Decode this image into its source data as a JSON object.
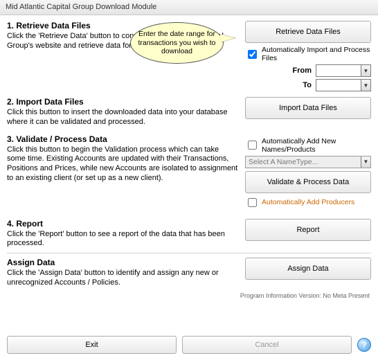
{
  "window": {
    "title": "Mid Atlantic Capital Group Download Module"
  },
  "sections": {
    "retrieve": {
      "heading": "1. Retrieve Data Files",
      "desc": "Click the 'Retrieve Data' button to connect to Mid Atlantic Capital Group's website and retrieve data for the specified date range.",
      "button": "Retrieve Data Files",
      "auto_import_label": "Automatically Import and Process Files",
      "auto_import_checked": true,
      "from_label": "From",
      "to_label": "To",
      "from_value": "",
      "to_value": "",
      "callout": "Enter the date range for transactions you wish to download"
    },
    "import": {
      "heading": "2. Import Data Files",
      "desc": "Click this button to insert the downloaded data into your database where it can be validated and processed.",
      "button": "Import Data Files"
    },
    "validate": {
      "heading": "3. Validate / Process Data",
      "desc": "Click this button to begin the Validation process which can take some time. Existing Accounts are updated with their Transactions, Positions and Prices, while new Accounts are isolated to assignment to an existing client (or set up as a new client).",
      "button": "Validate & Process Data",
      "auto_add_names_label": "Automatically Add New Names/Products",
      "auto_add_names_checked": false,
      "nametype_placeholder": "Select A NameType...",
      "auto_add_producers_label": "Automatically Add Producers",
      "auto_add_producers_checked": false
    },
    "report": {
      "heading": "4. Report",
      "desc": "Click the 'Report' button to see a report of the data that has been processed.",
      "button": "Report"
    },
    "assign": {
      "heading": "Assign Data",
      "desc": "Click the 'Assign Data' button to identify and assign any new or unrecognized Accounts / Policies.",
      "button": "Assign Data"
    }
  },
  "version_text": "Program Information Version: No Meta Present",
  "footer": {
    "exit": "Exit",
    "cancel": "Cancel"
  }
}
